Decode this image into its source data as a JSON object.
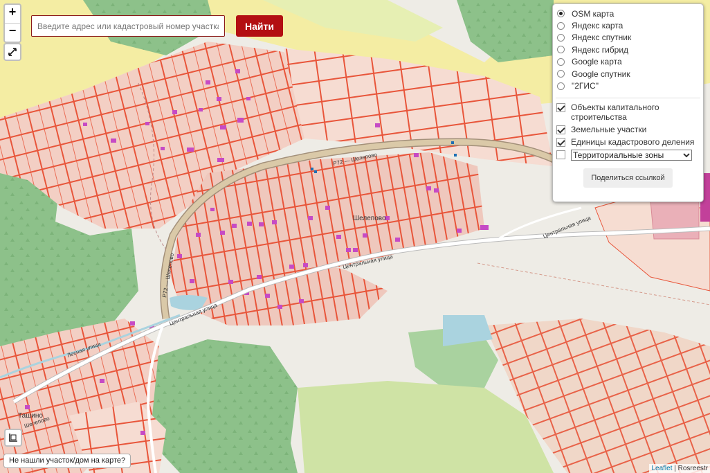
{
  "map": {
    "streets": {
      "p72_north": "Р72 — Шелепово",
      "p72_west": "Р72 — Шелепово",
      "central_west": "Центральная улица",
      "central_mid": "Центральная улица",
      "central_east": "Центральная улица",
      "lesnaya": "Лесная улица",
      "shelepovo_sw": "Шелепово"
    },
    "places": {
      "village": "Шелепово",
      "village_sw": "Ташино"
    }
  },
  "search": {
    "placeholder": "Введите адрес или кадастровый номер участка",
    "button_label": "Найти"
  },
  "zoom": {
    "in_label": "+",
    "out_label": "−"
  },
  "layers": {
    "base": [
      {
        "label": "OSM карта",
        "selected": true
      },
      {
        "label": "Яндекс карта",
        "selected": false
      },
      {
        "label": "Яндекс спутник",
        "selected": false
      },
      {
        "label": "Яндекс гибрид",
        "selected": false
      },
      {
        "label": "Google карта",
        "selected": false
      },
      {
        "label": "Google спутник",
        "selected": false
      },
      {
        "label": "\"2ГИС\"",
        "selected": false
      }
    ],
    "overlays": [
      {
        "label": "Объекты капитального строительства",
        "checked": true
      },
      {
        "label": "Земельные участки",
        "checked": true
      },
      {
        "label": "Единицы кадастрового деления",
        "checked": true
      }
    ],
    "zones": {
      "checked": false,
      "select_value": "Территориальные зоны"
    },
    "share_label": "Поделиться ссылкой"
  },
  "not_found_label": "Не нашли участок/дом на карте?",
  "attribution": {
    "leaflet": "Leaflet",
    "separator": " | ",
    "source": "Rosreestr"
  },
  "colors": {
    "parcel_stroke": "#e8553a",
    "parcel_fill": "#f3cfc4",
    "forest": "#8dc18a",
    "meadow": "#cfe3a5",
    "yellow_zone": "#f4eda3",
    "search_button": "#b30f12"
  }
}
